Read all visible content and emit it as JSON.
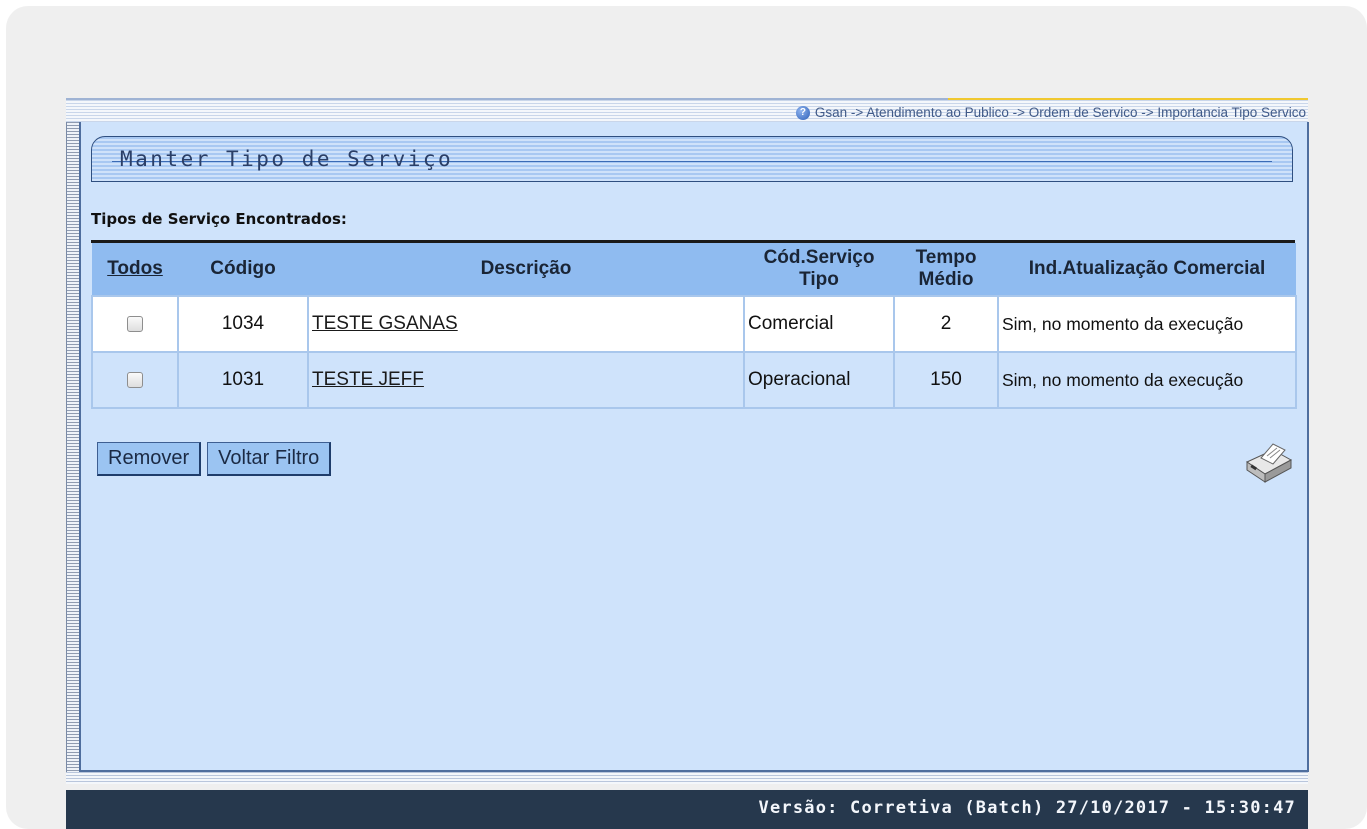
{
  "breadcrumb": {
    "help_icon": "help-icon",
    "text": "Gsan -> Atendimento ao Publico -> Ordem de Servico -> Importancia Tipo Servico"
  },
  "panel": {
    "title": "Manter Tipo de Serviço",
    "section_label": "Tipos de Serviço Encontrados:"
  },
  "table": {
    "headers": {
      "todos": "Todos",
      "codigo": "Código",
      "descricao": "Descrição",
      "cod_servico_tipo": "Cód.Serviço Tipo",
      "tempo_medio": "Tempo Médio",
      "ind_atualizacao": "Ind.Atualização Comercial"
    },
    "rows": [
      {
        "checked": false,
        "codigo": "1034",
        "descricao": "TESTE GSANAS",
        "cod_servico_tipo": "Comercial",
        "tempo_medio": "2",
        "ind_atualizacao": "Sim, no momento da execução"
      },
      {
        "checked": false,
        "codigo": "1031",
        "descricao": "TESTE JEFF",
        "cod_servico_tipo": "Operacional",
        "tempo_medio": "150",
        "ind_atualizacao": "Sim, no momento da execução"
      }
    ]
  },
  "buttons": {
    "remover": "Remover",
    "voltar_filtro": "Voltar Filtro",
    "print_icon": "printer-icon"
  },
  "footer": {
    "version": "Versão: Corretiva (Batch) 27/10/2017 - 15:30:47"
  },
  "colors": {
    "panel_bg": "#cfe3fb",
    "header_bg": "#8fbbf0",
    "footer_bg": "#26384d"
  }
}
